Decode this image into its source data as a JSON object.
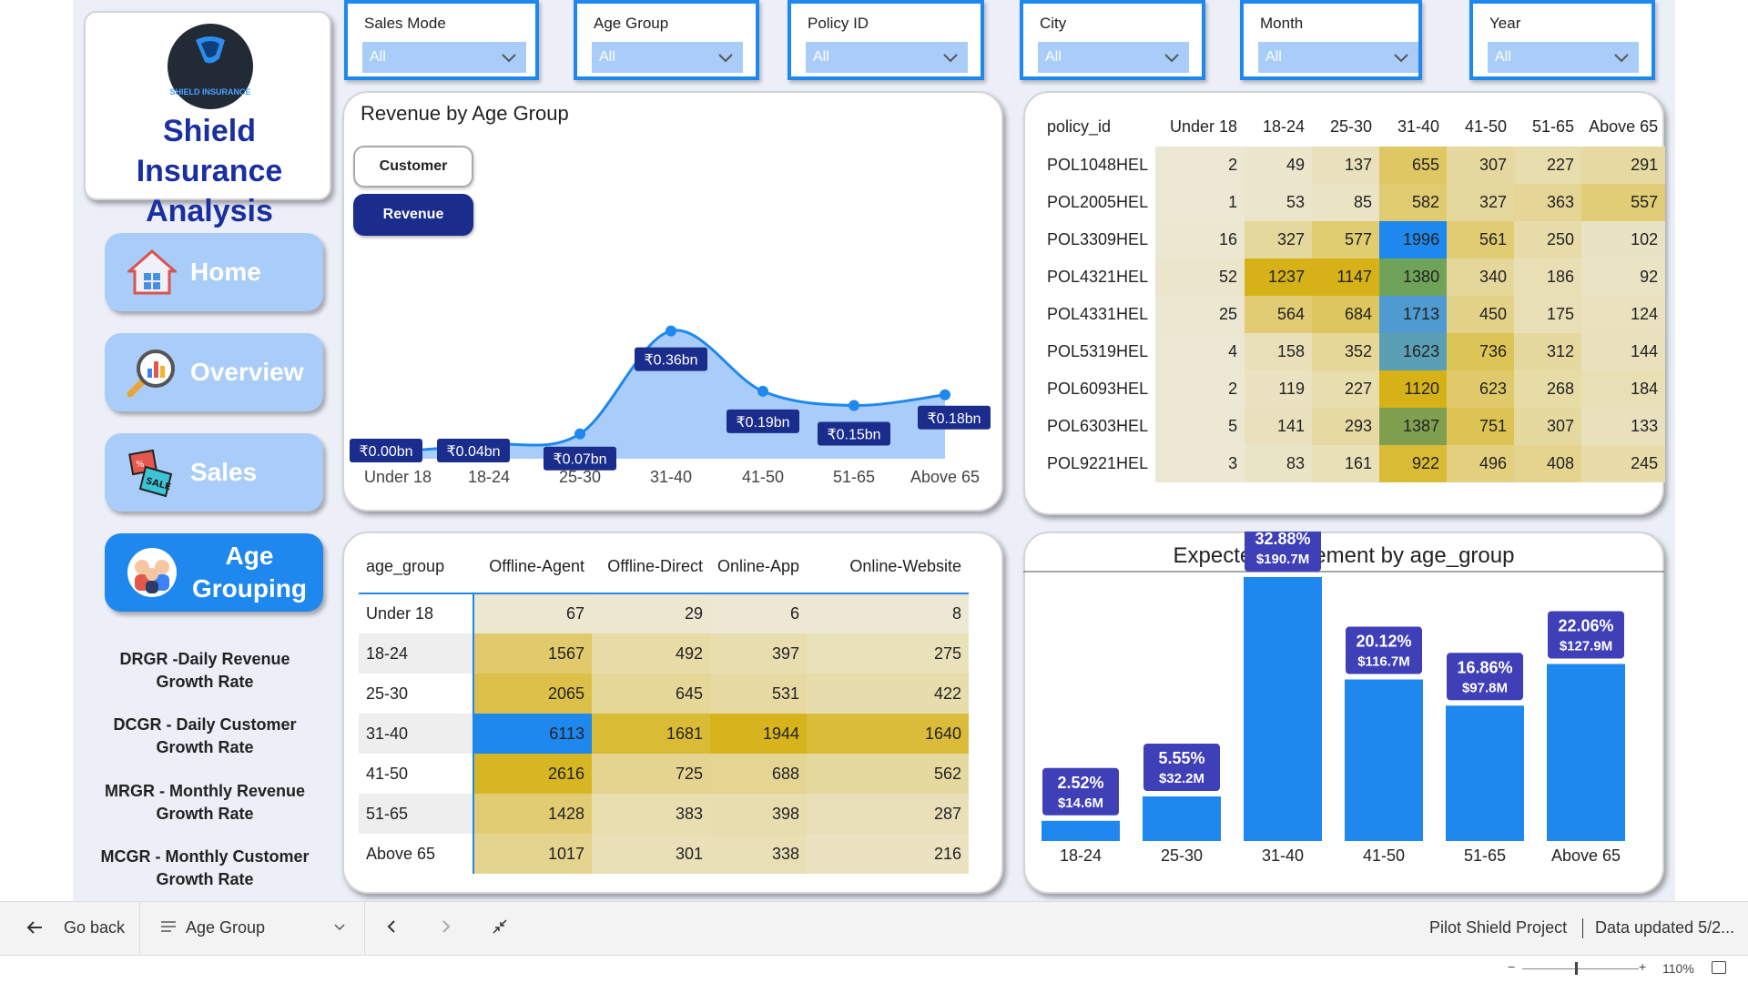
{
  "app": {
    "title": "Shield Insurance Analysis",
    "logo_text": "SHIELD INSURANCE"
  },
  "nav": {
    "home": "Home",
    "overview": "Overview",
    "sales": "Sales",
    "age_grouping": "Age Grouping"
  },
  "glossary": [
    "DRGR  -Daily Revenue Growth Rate",
    "DCGR - Daily Customer Growth Rate",
    "MRGR - Monthly Revenue Growth Rate",
    "MCGR - Monthly Customer Growth Rate"
  ],
  "slicers": [
    {
      "label": "Sales Mode",
      "value": "All"
    },
    {
      "label": "Age Group",
      "value": "All"
    },
    {
      "label": "Policy ID",
      "value": "All"
    },
    {
      "label": "City",
      "value": "All"
    },
    {
      "label": "Month",
      "value": "All"
    },
    {
      "label": "Year",
      "value": "All"
    }
  ],
  "revenue_chart": {
    "title": "Revenue by Age Group",
    "toggle_customer": "Customer",
    "toggle_revenue": "Revenue"
  },
  "chart_data": [
    {
      "type": "area",
      "title": "Revenue by Age Group",
      "categories": [
        "Under 18",
        "18-24",
        "25-30",
        "31-40",
        "41-50",
        "51-65",
        "Above 65"
      ],
      "values": [
        0.0,
        0.04,
        0.07,
        0.36,
        0.19,
        0.15,
        0.18
      ],
      "data_labels": [
        "₹0.00bn",
        "₹0.04bn",
        "₹0.07bn",
        "₹0.36bn",
        "₹0.19bn",
        "₹0.15bn",
        "₹0.18bn"
      ],
      "color": "#1e88ee",
      "fill": "#a9cdf8"
    },
    {
      "type": "bar",
      "title": "Expected Settlement by age_group",
      "categories": [
        "18-24",
        "25-30",
        "31-40",
        "41-50",
        "51-65",
        "Above 65"
      ],
      "values": [
        14.6,
        32.2,
        190.7,
        116.7,
        97.8,
        127.9
      ],
      "percent_labels": [
        "2.52%",
        "5.55%",
        "32.88%",
        "20.12%",
        "16.86%",
        "22.06%"
      ],
      "value_labels": [
        "$14.6M",
        "$32.2M",
        "$190.7M",
        "$116.7M",
        "$97.8M",
        "$127.9M"
      ],
      "color": "#1e88ee",
      "label_color": "#3f3fb8"
    }
  ],
  "policy_matrix": {
    "columns": [
      "policy_id",
      "Under 18",
      "18-24",
      "25-30",
      "31-40",
      "41-50",
      "51-65",
      "Above 65"
    ],
    "rows": [
      {
        "id": "POL1048HEL",
        "values": [
          2,
          49,
          137,
          655,
          307,
          227,
          291
        ]
      },
      {
        "id": "POL2005HEL",
        "values": [
          1,
          53,
          85,
          582,
          327,
          363,
          557
        ]
      },
      {
        "id": "POL3309HEL",
        "values": [
          16,
          327,
          577,
          1996,
          561,
          250,
          102
        ]
      },
      {
        "id": "POL4321HEL",
        "values": [
          52,
          1237,
          1147,
          1380,
          340,
          186,
          92
        ]
      },
      {
        "id": "POL4331HEL",
        "values": [
          25,
          564,
          684,
          1713,
          450,
          175,
          124
        ]
      },
      {
        "id": "POL5319HEL",
        "values": [
          4,
          158,
          352,
          1623,
          736,
          312,
          144
        ]
      },
      {
        "id": "POL6093HEL",
        "values": [
          2,
          119,
          227,
          1120,
          623,
          268,
          184
        ]
      },
      {
        "id": "POL6303HEL",
        "values": [
          5,
          141,
          293,
          1387,
          751,
          307,
          133
        ]
      },
      {
        "id": "POL9221HEL",
        "values": [
          3,
          83,
          161,
          922,
          496,
          408,
          245
        ]
      }
    ]
  },
  "channel_matrix": {
    "columns": [
      "age_group",
      "Offline-Agent",
      "Offline-Direct",
      "Online-App",
      "Online-Website"
    ],
    "rows": [
      {
        "group": "Under 18",
        "values": [
          67,
          29,
          6,
          8
        ]
      },
      {
        "group": "18-24",
        "values": [
          1567,
          492,
          397,
          275
        ]
      },
      {
        "group": "25-30",
        "values": [
          2065,
          645,
          531,
          422
        ]
      },
      {
        "group": "31-40",
        "values": [
          6113,
          1681,
          1944,
          1640
        ]
      },
      {
        "group": "41-50",
        "values": [
          2616,
          725,
          688,
          562
        ]
      },
      {
        "group": "51-65",
        "values": [
          1428,
          383,
          398,
          287
        ]
      },
      {
        "group": "Above 65",
        "values": [
          1017,
          301,
          338,
          216
        ]
      }
    ]
  },
  "statusbar": {
    "go_back": "Go back",
    "page_name": "Age Group",
    "project": "Pilot Shield Project",
    "updated": "Data updated 5/2...",
    "zoom": "110%"
  }
}
